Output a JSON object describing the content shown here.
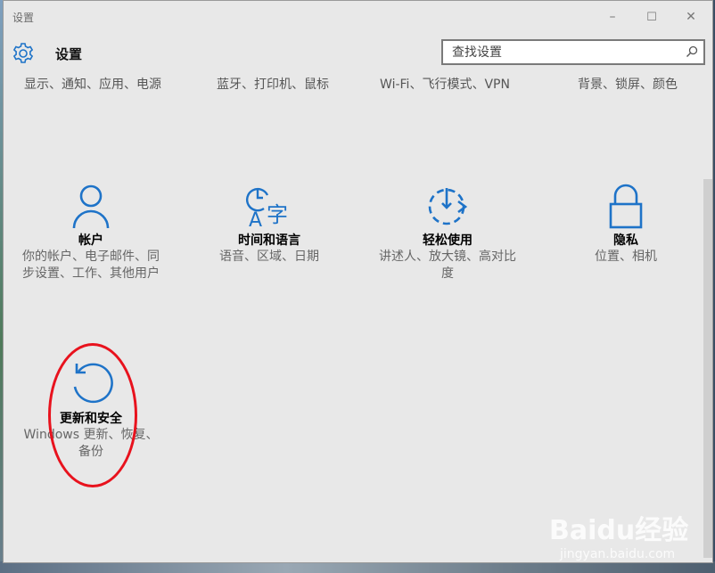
{
  "window": {
    "title": "设置",
    "minimize": "–",
    "maximize": "☐",
    "close": "✕"
  },
  "header": {
    "title": "设置",
    "icon": "gear-icon"
  },
  "search": {
    "placeholder": "查找设置",
    "icon": "search-icon"
  },
  "top_categories": [
    {
      "desc": "显示、通知、应用、电源"
    },
    {
      "desc": "蓝牙、打印机、鼠标"
    },
    {
      "desc": "Wi-Fi、飞行模式、VPN"
    },
    {
      "desc": "背景、锁屏、颜色"
    }
  ],
  "tiles": [
    {
      "name": "帐户",
      "desc": "你的帐户、电子邮件、同步设置、工作、其他用户",
      "icon": "person-icon"
    },
    {
      "name": "时间和语言",
      "desc": "语音、区域、日期",
      "icon": "time-language-icon"
    },
    {
      "name": "轻松使用",
      "desc": "讲述人、放大镜、高对比度",
      "icon": "ease-of-access-icon"
    },
    {
      "name": "隐私",
      "desc": "位置、相机",
      "icon": "lock-icon"
    },
    {
      "name": "更新和安全",
      "desc": "Windows 更新、恢复、备份",
      "icon": "refresh-icon"
    }
  ],
  "colors": {
    "accent": "#1e73c8",
    "annotation": "#e8121d"
  },
  "watermark": {
    "brand": "Baidu经验",
    "url": "jingyan.baidu.com"
  }
}
